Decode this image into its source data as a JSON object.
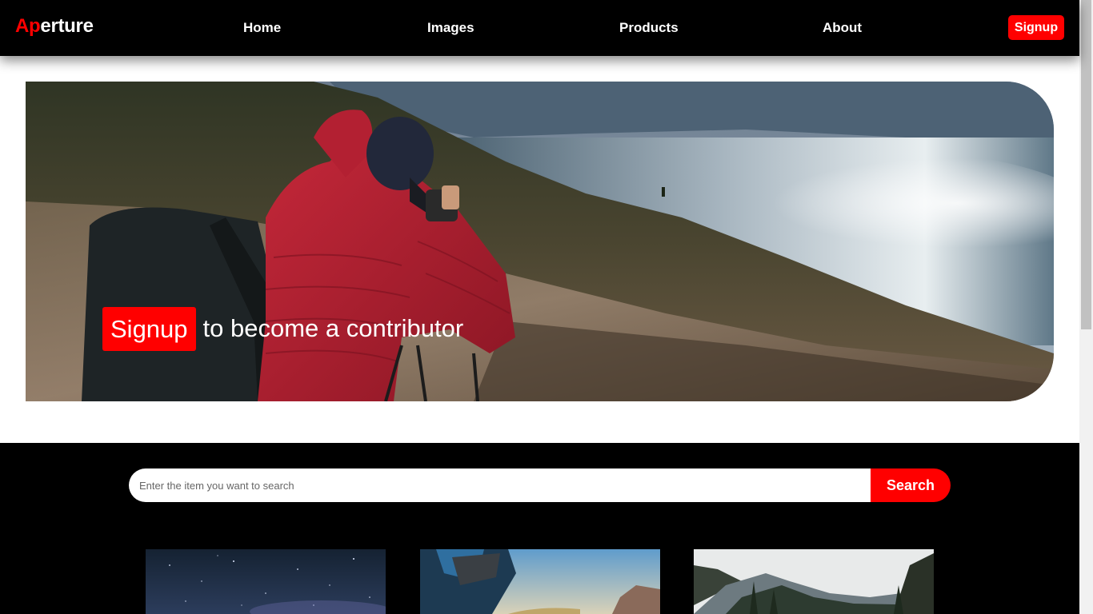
{
  "brand": {
    "accent_part": "Ap",
    "rest_part": "erture",
    "accent_color": "#ff0000"
  },
  "nav": {
    "links": [
      "Home",
      "Images",
      "Products",
      "About"
    ],
    "signup_label": "Signup"
  },
  "hero": {
    "image": "photographer-red-jacket-on-hillside-by-lake",
    "signup_label": "Signup",
    "tagline": "to become a contributor"
  },
  "search": {
    "placeholder": "Enter the item you want to search",
    "value": "",
    "button_label": "Search"
  },
  "gallery": {
    "items": [
      {
        "image": "starry-night-sky"
      },
      {
        "image": "person-with-backpack-mountains"
      },
      {
        "image": "mountain-valley-forest"
      }
    ]
  },
  "colors": {
    "brand_red": "#ff0000",
    "dark_bg": "#000000"
  }
}
